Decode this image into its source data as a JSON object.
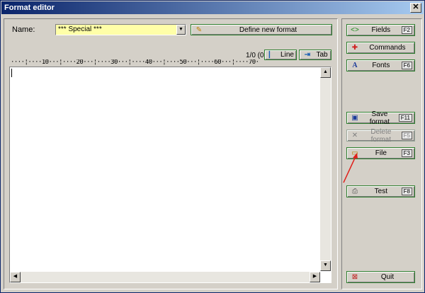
{
  "window": {
    "title": "Format editor",
    "close_glyph": "✕"
  },
  "name_field": {
    "label": "Name:",
    "value": "*** Special ***"
  },
  "define_button": {
    "label": "Define new format",
    "icon": "pencil-icon"
  },
  "status": {
    "counter": "1/0 (0)"
  },
  "line_button": {
    "label": "Line",
    "icon": "line-cursor-icon"
  },
  "tab_button": {
    "label": "Tab",
    "icon": "tab-icon"
  },
  "ruler": {
    "text": "····¦····10···¦····20···¦····30···¦····40···¦····50···¦····60···¦····70·"
  },
  "sidebar": {
    "fields": {
      "label": "Fields",
      "key": "F2",
      "icon": "fields-icon"
    },
    "commands": {
      "label": "Commands",
      "icon": "commands-icon"
    },
    "fonts": {
      "label": "Fonts",
      "key": "F6",
      "icon": "font-icon"
    },
    "save_format": {
      "label": "Save format",
      "key": "F11",
      "icon": "floppy-icon"
    },
    "delete_format": {
      "label": "Delete format",
      "key": "F5",
      "icon": "delete-icon"
    },
    "file": {
      "label": "File",
      "key": "F3",
      "icon": "folder-icon"
    },
    "test": {
      "label": "Test",
      "key": "F8",
      "icon": "printer-icon"
    },
    "quit": {
      "label": "Quit",
      "icon": "quit-icon"
    }
  },
  "colors": {
    "accent_green": "#2d7d2d",
    "name_bg": "#ffffa8",
    "title_bar": "#0a246a",
    "annotation_arrow": "#e0201b"
  }
}
